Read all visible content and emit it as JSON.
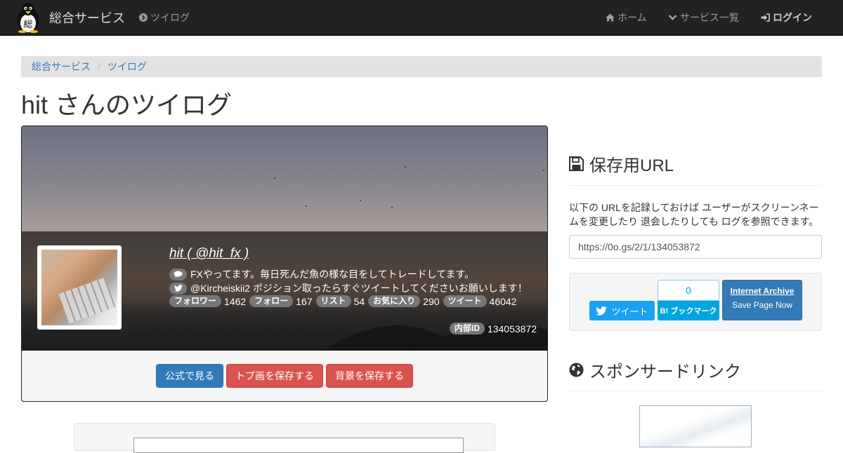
{
  "navbar": {
    "brand": "総合サービス",
    "logo_char": "総",
    "app_link": "ツイログ",
    "links": {
      "home": "ホーム",
      "services": "サービス一覧",
      "login": "ログイン"
    }
  },
  "breadcrumb": [
    "総合サービス",
    "ツイログ"
  ],
  "page_title": "hit さんのツイログ",
  "profile": {
    "name": "hit ( @hit_fx )",
    "bio": "FXやってます。毎日死んだ魚の様な目をしてトレードしてます。",
    "tweet_text": "@Kircheiskii2 ポジション取ったらすぐツイートしてくださいお願いします！",
    "stats": [
      {
        "label": "フォロワー",
        "value": "1462"
      },
      {
        "label": "フォロー",
        "value": "167"
      },
      {
        "label": "リスト",
        "value": "54"
      },
      {
        "label": "お気に入り",
        "value": "290"
      },
      {
        "label": "ツイート",
        "value": "46042"
      }
    ],
    "internal_id_label": "内部ID",
    "internal_id": "134053872"
  },
  "actions": {
    "official": "公式で見る",
    "save_top": "トプ画を保存する",
    "save_bg": "背景を保存する"
  },
  "save_url": {
    "title": "保存用URL",
    "description": "以下の URLを記録しておけば ユーザーがスクリーンネームを変更したり 退会したりしても ログを参照できます。",
    "url": "https://0o.gs/2/1/134053872"
  },
  "share": {
    "tweet": "ツイート",
    "hatena_count": "0",
    "hatena_label": "B! ブックマーク",
    "ia_title": "Internet Archive",
    "ia_sub": "Save Page Now"
  },
  "sponsor": {
    "title": "スポンサードリンク"
  },
  "colors": {
    "navbar": "#222222",
    "link": "#337ab7",
    "danger": "#d9534f",
    "twitter": "#1da1f2",
    "hatena": "#00a4de"
  }
}
